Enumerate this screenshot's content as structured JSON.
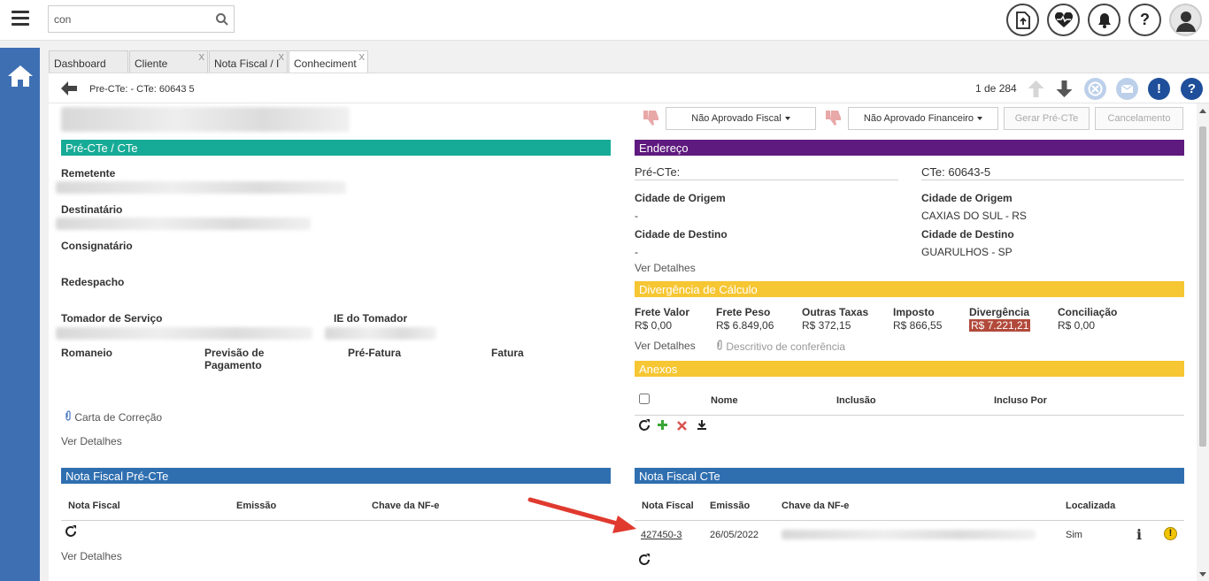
{
  "search": {
    "placeholder": "con"
  },
  "tabs": [
    {
      "label": "Dashboard",
      "close": ""
    },
    {
      "label": "Cliente",
      "close": "X"
    },
    {
      "label": "Nota Fiscal / I",
      "close": "X"
    },
    {
      "label": "Conheciment",
      "close": "X"
    }
  ],
  "toolbar": {
    "breadcrumb": "Pre-CTe: - CTe: 60643 5",
    "pager": "1 de 284",
    "buttons": {
      "nao_aprovado_fiscal": "Não Aprovado Fiscal",
      "nao_aprovado_financeiro": "Não Aprovado Financeiro",
      "gerar_pre_cte": "Gerar Pré-CTe",
      "cancelamento": "Cancelamento"
    }
  },
  "left": {
    "section_title": "Pré-CTe / CTe",
    "remetente": "Remetente",
    "destinatario": "Destinatário",
    "consignatario": "Consignatário",
    "redespacho": "Redespacho",
    "tomador": "Tomador de Serviço",
    "ie_tomador": "IE do Tomador",
    "romaneio": "Romaneio",
    "previsao": "Previsão de Pagamento",
    "pre_fatura": "Pré-Fatura",
    "fatura": "Fatura",
    "carta": "Carta de Correção",
    "ver_detalhes": "Ver Detalhes"
  },
  "endereco": {
    "title": "Endereço",
    "pre_cte_label": "Pré-CTe:",
    "cte_label": "CTe: 60643-5",
    "origem_label": "Cidade de Origem",
    "destino_label": "Cidade de Destino",
    "pre_origem": "-",
    "pre_destino": "-",
    "cte_origem": "CAXIAS DO SUL - RS",
    "cte_destino": "GUARULHOS - SP",
    "ver_detalhes": "Ver Detalhes"
  },
  "divergencia": {
    "title": "Divergência de Cálculo",
    "frete_valor_label": "Frete Valor",
    "frete_valor": "R$ 0,00",
    "frete_peso_label": "Frete Peso",
    "frete_peso": "R$ 6.849,06",
    "outras_label": "Outras Taxas",
    "outras": "R$ 372,15",
    "imposto_label": "Imposto",
    "imposto": "R$ 866,55",
    "divergencia_label": "Divergência",
    "divergencia": "R$ 7.221,21",
    "conciliacao_label": "Conciliação",
    "conciliacao": "R$ 0,00",
    "ver_detalhes": "Ver Detalhes",
    "descritivo": "Descritivo de conferência"
  },
  "anexos": {
    "title": "Anexos",
    "col_nome": "Nome",
    "col_inclusao": "Inclusão",
    "col_incluso_por": "Incluso Por"
  },
  "nf_pre": {
    "title": "Nota Fiscal Pré-CTe",
    "col_nf": "Nota Fiscal",
    "col_emissao": "Emissão",
    "col_chave": "Chave da NF-e",
    "ver_detalhes": "Ver Detalhes"
  },
  "nf_cte": {
    "title": "Nota Fiscal CTe",
    "col_nf": "Nota Fiscal",
    "col_emissao": "Emissão",
    "col_chave": "Chave da NF-e",
    "col_localizada": "Localizada",
    "rows": [
      {
        "nf": "427450-3",
        "emissao": "26/05/2022",
        "localizada": "Sim",
        "info": "i",
        "warn": "!"
      }
    ]
  },
  "colors": {
    "teal": "#16ab96",
    "purple": "#5f1a7f",
    "yellow": "#f6c633",
    "blue": "#2f6fb0",
    "rail": "#3e6fb3",
    "arrow": "#e03a2f"
  }
}
